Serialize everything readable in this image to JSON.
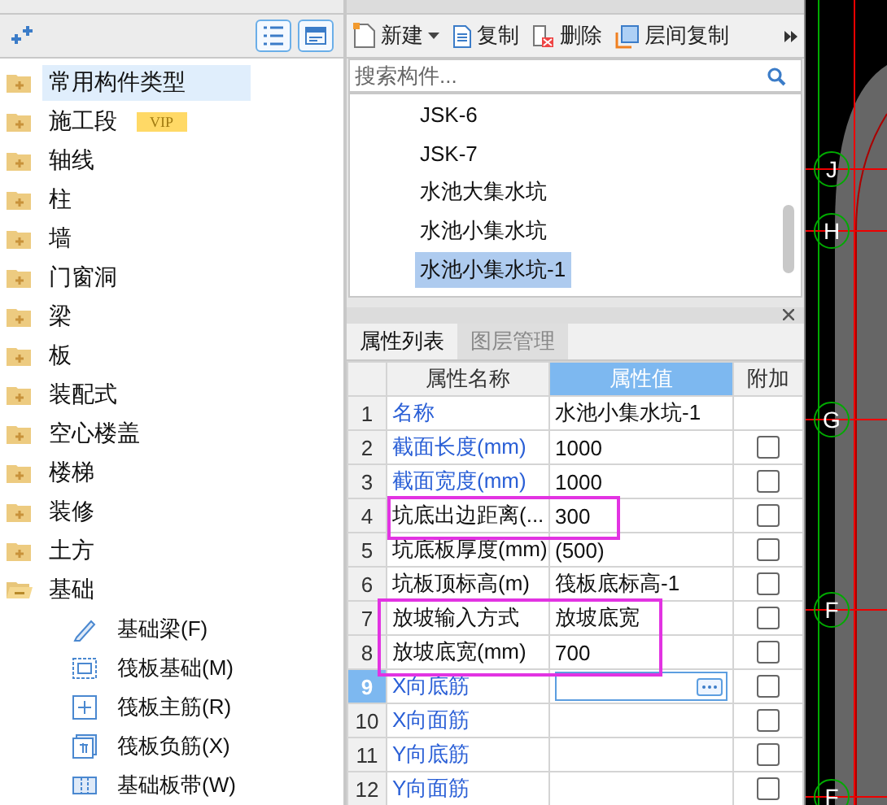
{
  "nav": {
    "tree": [
      {
        "label": "常用构件类型",
        "selected": true,
        "expanded": false
      },
      {
        "label": "施工段",
        "badge": "VIP",
        "selected": false,
        "expanded": false
      },
      {
        "label": "轴线",
        "selected": false,
        "expanded": false
      },
      {
        "label": "柱",
        "selected": false,
        "expanded": false
      },
      {
        "label": "墙",
        "selected": false,
        "expanded": false
      },
      {
        "label": "门窗洞",
        "selected": false,
        "expanded": false
      },
      {
        "label": "梁",
        "selected": false,
        "expanded": false
      },
      {
        "label": "板",
        "selected": false,
        "expanded": false
      },
      {
        "label": "装配式",
        "selected": false,
        "expanded": false
      },
      {
        "label": "空心楼盖",
        "selected": false,
        "expanded": false
      },
      {
        "label": "楼梯",
        "selected": false,
        "expanded": false
      },
      {
        "label": "装修",
        "selected": false,
        "expanded": false
      },
      {
        "label": "土方",
        "selected": false,
        "expanded": false
      },
      {
        "label": "基础",
        "selected": false,
        "expanded": true,
        "children": [
          {
            "label": "基础梁(F)",
            "kind": "beam",
            "selected": false
          },
          {
            "label": "筏板基础(M)",
            "kind": "raft",
            "selected": false
          },
          {
            "label": "筏板主筋(R)",
            "kind": "main-rebar",
            "selected": false
          },
          {
            "label": "筏板负筋(X)",
            "kind": "neg-rebar",
            "selected": false
          },
          {
            "label": "基础板带(W)",
            "kind": "strip",
            "selected": false
          }
        ]
      }
    ]
  },
  "component_list": {
    "toolbar": [
      {
        "label": "新建",
        "kind": "new"
      },
      {
        "label": "复制",
        "kind": "copy"
      },
      {
        "label": "删除",
        "kind": "delete"
      },
      {
        "label": "层间复制",
        "kind": "floor-copy"
      }
    ],
    "search": {
      "placeholder": "搜索构件..."
    },
    "items": [
      {
        "label": "JSK-6",
        "selected": false
      },
      {
        "label": "JSK-7",
        "selected": false
      },
      {
        "label": "水池大集水坑",
        "selected": false
      },
      {
        "label": "水池小集水坑",
        "selected": false
      },
      {
        "label": "水池小集水坑-1",
        "selected": true
      }
    ]
  },
  "properties": {
    "tabs": [
      {
        "label": "属性列表",
        "selected": true
      },
      {
        "label": "图层管理",
        "selected": false
      }
    ],
    "columns": [
      "属性名称",
      "属性值",
      "附加"
    ],
    "rows": [
      {
        "num": "1",
        "name": "名称",
        "value": "水池小集水坑-1",
        "public": true,
        "selected": false,
        "highlighted": false
      },
      {
        "num": "2",
        "name": "截面长度(mm)",
        "value": "1000",
        "public": true,
        "checked": false,
        "selected": false,
        "highlighted": false
      },
      {
        "num": "3",
        "name": "截面宽度(mm)",
        "value": "1000",
        "public": true,
        "checked": false,
        "selected": false,
        "highlighted": false
      },
      {
        "num": "4",
        "name": "坑底出边距离(...",
        "value": "300",
        "public": false,
        "checked": false,
        "selected": false,
        "highlighted": true
      },
      {
        "num": "5",
        "name": "坑底板厚度(mm)",
        "value": "(500)",
        "public": false,
        "checked": false,
        "selected": false,
        "highlighted": false
      },
      {
        "num": "6",
        "name": "坑板顶标高(m)",
        "value": "筏板底标高-1",
        "public": false,
        "checked": false,
        "selected": false,
        "highlighted": false
      },
      {
        "num": "7",
        "name": "放坡输入方式",
        "value": "放坡底宽",
        "public": false,
        "checked": false,
        "selected": false,
        "highlighted": true
      },
      {
        "num": "8",
        "name": "放坡底宽(mm)",
        "value": "700",
        "public": false,
        "checked": false,
        "selected": false,
        "highlighted": true
      },
      {
        "num": "9",
        "name": "X向底筋",
        "value": "",
        "public": true,
        "checked": false,
        "selected": true,
        "highlighted": false
      },
      {
        "num": "10",
        "name": "X向面筋",
        "value": "",
        "public": true,
        "checked": false,
        "selected": false,
        "highlighted": false
      },
      {
        "num": "11",
        "name": "Y向底筋",
        "value": "",
        "public": true,
        "checked": false,
        "selected": false,
        "highlighted": false
      },
      {
        "num": "12",
        "name": "Y向面筋",
        "value": "",
        "public": true,
        "checked": false,
        "selected": false,
        "highlighted": false
      }
    ]
  },
  "canvas": {
    "axes": [
      "J",
      "H",
      "G",
      "F",
      "F"
    ]
  }
}
